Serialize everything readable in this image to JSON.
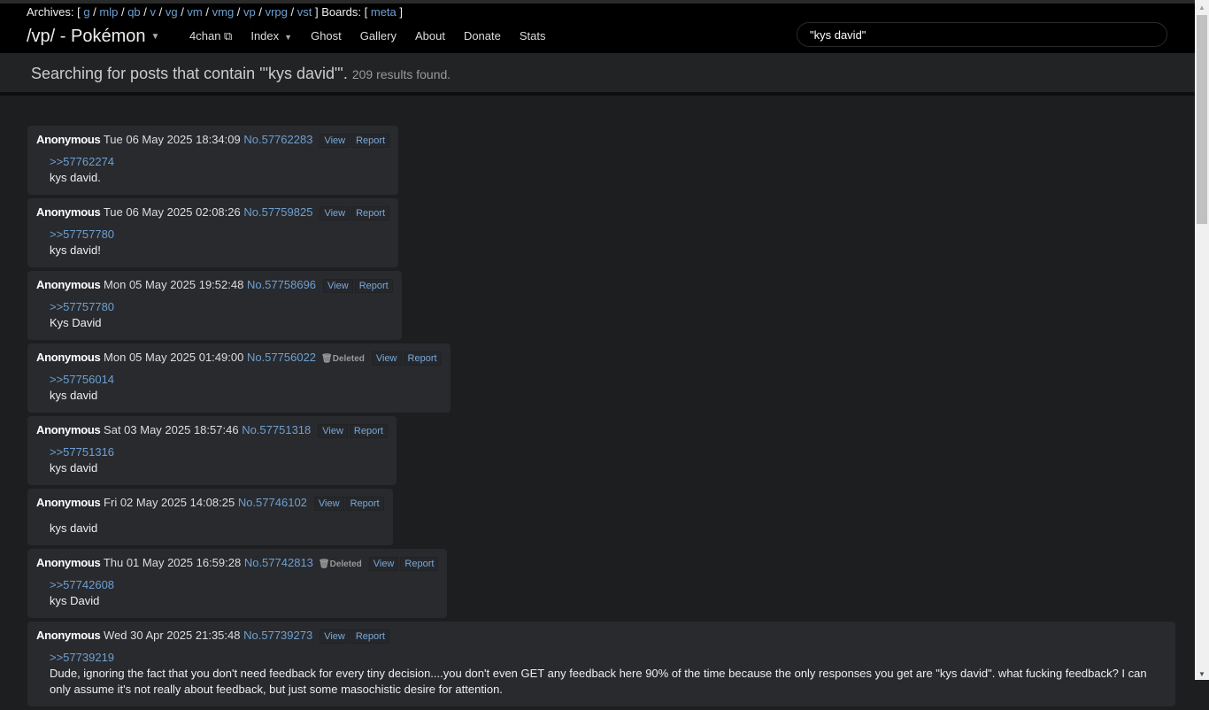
{
  "archives": {
    "label": "Archives:",
    "boards": [
      "g",
      "mlp",
      "qb",
      "v",
      "vg",
      "vm",
      "vmg",
      "vp",
      "vrpg",
      "vst"
    ],
    "boards_label": "Boards:",
    "meta": "meta"
  },
  "brand": "/vp/ - Pokémon",
  "nav": {
    "fourchan": "4chan",
    "index": "Index",
    "ghost": "Ghost",
    "gallery": "Gallery",
    "about": "About",
    "donate": "Donate",
    "stats": "Stats"
  },
  "search": {
    "value": "\"kys david\""
  },
  "results": {
    "title": "Searching for posts that contain '\"kys david\"'.",
    "count": "209 results found."
  },
  "buttons": {
    "view": "View",
    "report": "Report",
    "deleted": "Deleted"
  },
  "posts": [
    {
      "name": "Anonymous",
      "date": "Tue 06 May 2025 18:34:09",
      "no": "No.57762283",
      "quote": ">>57762274",
      "text": "kys david.",
      "deleted": false
    },
    {
      "name": "Anonymous",
      "date": "Tue 06 May 2025 02:08:26",
      "no": "No.57759825",
      "quote": ">>57757780",
      "text": "kys david!",
      "deleted": false
    },
    {
      "name": "Anonymous",
      "date": "Mon 05 May 2025 19:52:48",
      "no": "No.57758696",
      "quote": ">>57757780",
      "text": "Kys David",
      "deleted": false
    },
    {
      "name": "Anonymous",
      "date": "Mon 05 May 2025 01:49:00",
      "no": "No.57756022",
      "quote": ">>57756014",
      "text": "kys david",
      "deleted": true
    },
    {
      "name": "Anonymous",
      "date": "Sat 03 May 2025 18:57:46",
      "no": "No.57751318",
      "quote": ">>57751316",
      "text": "kys david",
      "deleted": false
    },
    {
      "name": "Anonymous",
      "date": "Fri 02 May 2025 14:08:25",
      "no": "No.57746102",
      "quote": "",
      "text": "kys david",
      "deleted": false
    },
    {
      "name": "Anonymous",
      "date": "Thu 01 May 2025 16:59:28",
      "no": "No.57742813",
      "quote": ">>57742608",
      "text": "kys David",
      "deleted": true
    },
    {
      "name": "Anonymous",
      "date": "Wed 30 Apr 2025 21:35:48",
      "no": "No.57739273",
      "quote": ">>57739219",
      "text": "Dude, ignoring the fact that you don't need feedback for every tiny decision....you don't even GET any feedback here 90% of the time because the only responses you get are \"kys david\". what fucking feedback? I can only assume it's not really about feedback, but just some masochistic desire for attention.",
      "deleted": false
    }
  ]
}
